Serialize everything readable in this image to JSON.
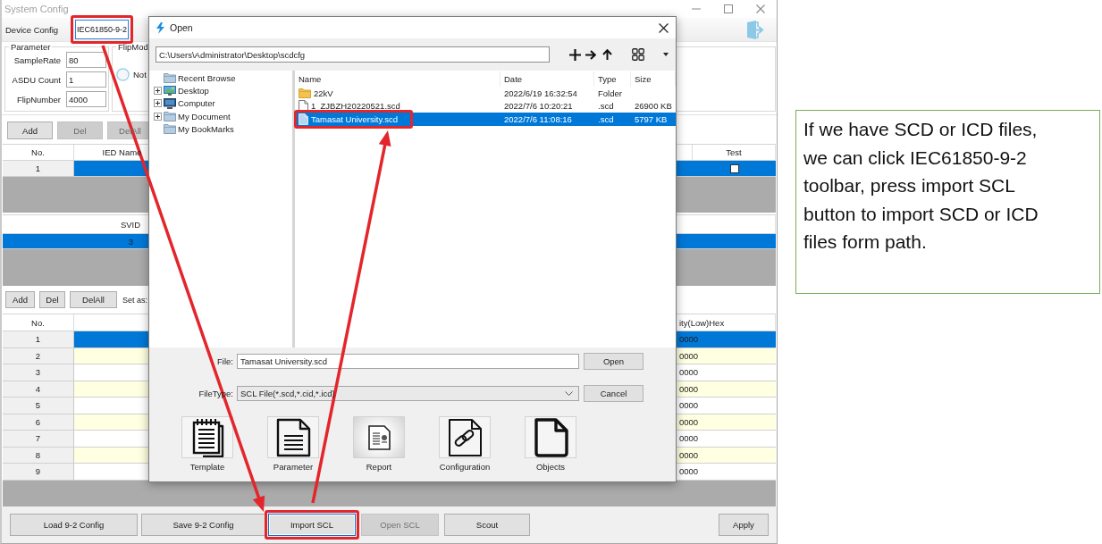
{
  "window": {
    "title": "System Config"
  },
  "device_config": {
    "label": "Device Config",
    "tabs": [
      {
        "label": "IEC61850-9-2",
        "selected": true,
        "highlighted": true
      }
    ]
  },
  "parameter": {
    "title": "Parameter",
    "fields": [
      {
        "label": "SampleRate",
        "value": "80"
      },
      {
        "label": "ASDU Count",
        "value": "1"
      },
      {
        "label": "FlipNumber",
        "value": "4000"
      }
    ]
  },
  "flip_mode": {
    "title": "FlipMod",
    "options": [
      {
        "label": "Not",
        "selected": false
      }
    ]
  },
  "ied_buttons": [
    {
      "label": "Add",
      "disabled": false
    },
    {
      "label": "Del",
      "disabled": true
    },
    {
      "label": "DelAll",
      "disabled": true
    }
  ],
  "ied_table": {
    "columns": [
      "No.",
      "IED Name",
      "Test"
    ],
    "rows": [
      {
        "no": "1",
        "selected": true,
        "test": false
      }
    ]
  },
  "sv_table": {
    "columns": [
      "SVID"
    ],
    "rows": [
      {
        "svid": "3",
        "selected": true
      }
    ]
  },
  "channel_toolbar": {
    "buttons": [
      {
        "label": "Add",
        "disabled": false
      },
      {
        "label": "Del",
        "disabled": false
      },
      {
        "label": "DelAll",
        "disabled": false
      }
    ],
    "set_as": "Set as:"
  },
  "channel_table": {
    "columns": [
      "No.",
      "ity(Low)Hex"
    ],
    "rows": [
      {
        "no": "1",
        "value": "0000",
        "selected": true
      },
      {
        "no": "2",
        "value": "0000",
        "selected": false
      },
      {
        "no": "3",
        "value": "0000",
        "selected": false
      },
      {
        "no": "4",
        "value": "0000",
        "selected": false
      },
      {
        "no": "5",
        "value": "0000",
        "selected": false
      },
      {
        "no": "6",
        "value": "0000",
        "selected": false
      },
      {
        "no": "7",
        "value": "0000",
        "selected": false
      },
      {
        "no": "8",
        "value": "0000",
        "selected": false
      },
      {
        "no": "9",
        "value": "0000",
        "selected": false
      }
    ]
  },
  "bottom_buttons": [
    {
      "label": "Load 9-2 Config",
      "disabled": false,
      "focused": false,
      "highlighted": false
    },
    {
      "label": "Save 9-2 Config",
      "disabled": false,
      "focused": false,
      "highlighted": false
    },
    {
      "label": "Import SCL",
      "disabled": false,
      "focused": true,
      "highlighted": true
    },
    {
      "label": "Open SCL",
      "disabled": true,
      "focused": false,
      "highlighted": false
    },
    {
      "label": "Scout",
      "disabled": false,
      "focused": false,
      "highlighted": false
    },
    {
      "label": "Apply",
      "disabled": false,
      "focused": false,
      "highlighted": false
    }
  ],
  "open_dialog": {
    "title": "Open",
    "path": "C:\\Users\\Administrator\\Desktop\\scdcfg",
    "tree": [
      {
        "label": "Recent Browse",
        "kind": "folder",
        "expandable": false,
        "expanded": false
      },
      {
        "label": "Desktop",
        "kind": "desktop",
        "expandable": true,
        "expanded": false
      },
      {
        "label": "Computer",
        "kind": "computer",
        "expandable": true,
        "expanded": false
      },
      {
        "label": "My Document",
        "kind": "folder",
        "expandable": true,
        "expanded": false
      },
      {
        "label": "My BookMarks",
        "kind": "folder",
        "expandable": false,
        "expanded": false
      }
    ],
    "columns": [
      "Name",
      "Date",
      "Type",
      "Size"
    ],
    "files": [
      {
        "kind": "folder",
        "name": "22kV",
        "date": "2022/6/19 16:32:54",
        "type": "Folder",
        "selected": false,
        "highlighted": false
      },
      {
        "kind": "file",
        "name": "1_ZJBZH20220521.scd",
        "date": "2022/7/6 10:20:21",
        "type": ".scd",
        "size": "26900 KB",
        "selected": false,
        "highlighted": false
      },
      {
        "kind": "file",
        "name": "Tamasat University.scd",
        "date": "2022/7/6 11:08:16",
        "type": ".scd",
        "size": "5797 KB",
        "selected": true,
        "highlighted": true
      }
    ],
    "file": {
      "label": "File:",
      "value": "Tamasat University.scd"
    },
    "file_type": {
      "label": "FileType:",
      "value": "SCL File(*.scd,*.cid,*.icd)"
    },
    "buttons": [
      "Open",
      "Cancel"
    ],
    "shortcuts": [
      {
        "label": "Template",
        "kind": "template",
        "selected": false
      },
      {
        "label": "Parameter",
        "kind": "parameter",
        "selected": false
      },
      {
        "label": "Report",
        "kind": "report",
        "selected": true
      },
      {
        "label": "Configuration",
        "kind": "configuration",
        "selected": false
      },
      {
        "label": "Objects",
        "kind": "objects",
        "selected": false
      }
    ]
  },
  "note": "If we have SCD or ICD files, we can click IEC61850-9-2 toolbar, press import SCL button to import SCD or ICD files form path."
}
